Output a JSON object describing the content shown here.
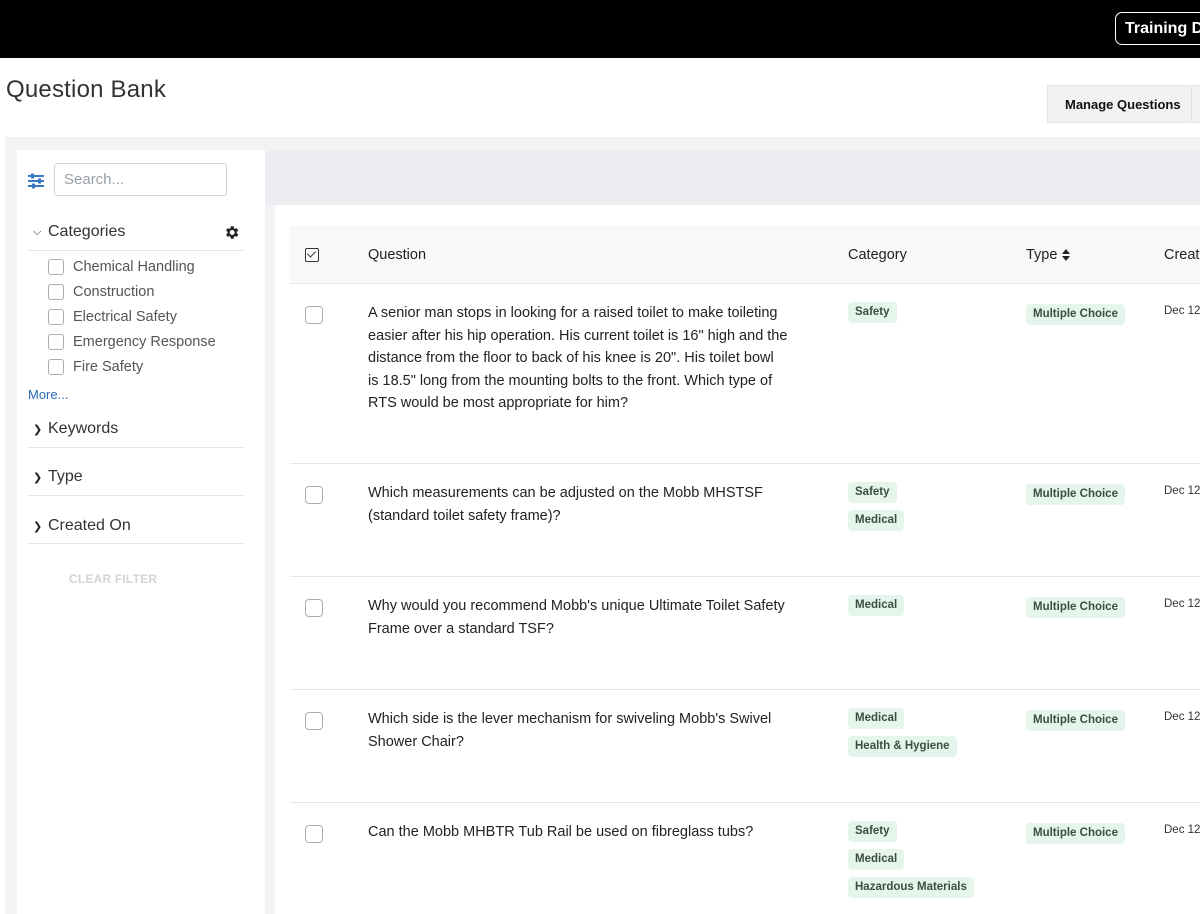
{
  "topbar": {
    "button_label": "Training D"
  },
  "page": {
    "title": "Question Bank"
  },
  "toolbar": {
    "manage_label": "Manage Questions"
  },
  "sidebar": {
    "search_placeholder": "Search...",
    "categories": {
      "label": "Categories",
      "items": [
        "Chemical Handling",
        "Construction",
        "Electrical Safety",
        "Emergency Response",
        "Fire Safety"
      ],
      "more_label": "More..."
    },
    "keywords_label": "Keywords",
    "type_label": "Type",
    "created_on_label": "Created On",
    "clear_filter_label": "CLEAR FILTER"
  },
  "table": {
    "headers": {
      "question": "Question",
      "category": "Category",
      "type": "Type",
      "created": "Creat"
    },
    "rows": [
      {
        "question": "A senior man stops in looking for a raised toilet to make toileting easier after his hip operation. His current toilet is 16\" high and the distance from the floor to back of his knee is 20\". His toilet bowl is 18.5\" long from the mounting bolts to the front. Which type of RTS would be most appropriate for him?",
        "categories": [
          "Safety"
        ],
        "type": "Multiple Choice",
        "created": "Dec 12"
      },
      {
        "question": "Which measurements can be adjusted on the Mobb MHSTSF (standard toilet safety frame)?",
        "categories": [
          "Safety",
          "Medical"
        ],
        "type": "Multiple Choice",
        "created": "Dec 12"
      },
      {
        "question": "Why would you recommend Mobb's unique Ultimate Toilet Safety Frame over a standard TSF?",
        "categories": [
          "Medical"
        ],
        "type": "Multiple Choice",
        "created": "Dec 12"
      },
      {
        "question": "Which side is the lever mechanism for swiveling Mobb's Swivel Shower Chair?",
        "categories": [
          "Medical",
          "Health & Hygiene"
        ],
        "type": "Multiple Choice",
        "created": "Dec 12"
      },
      {
        "question": "Can the Mobb MHBTR Tub Rail be used on fibreglass tubs?",
        "categories": [
          "Safety",
          "Medical",
          "Hazardous Materials"
        ],
        "type": "Multiple Choice",
        "created": "Dec 12"
      }
    ]
  },
  "icons": {
    "filter": "sliders-icon",
    "settings": "gear-icon",
    "expand": "chevron-down-icon",
    "collapse": "chevron-right-icon",
    "sort": "sort-icon"
  },
  "colors": {
    "topbar": "#000000",
    "tag_bg": "#e5f5ec",
    "link": "#2a6bb5",
    "panel_bg": "#f2f3f5"
  }
}
